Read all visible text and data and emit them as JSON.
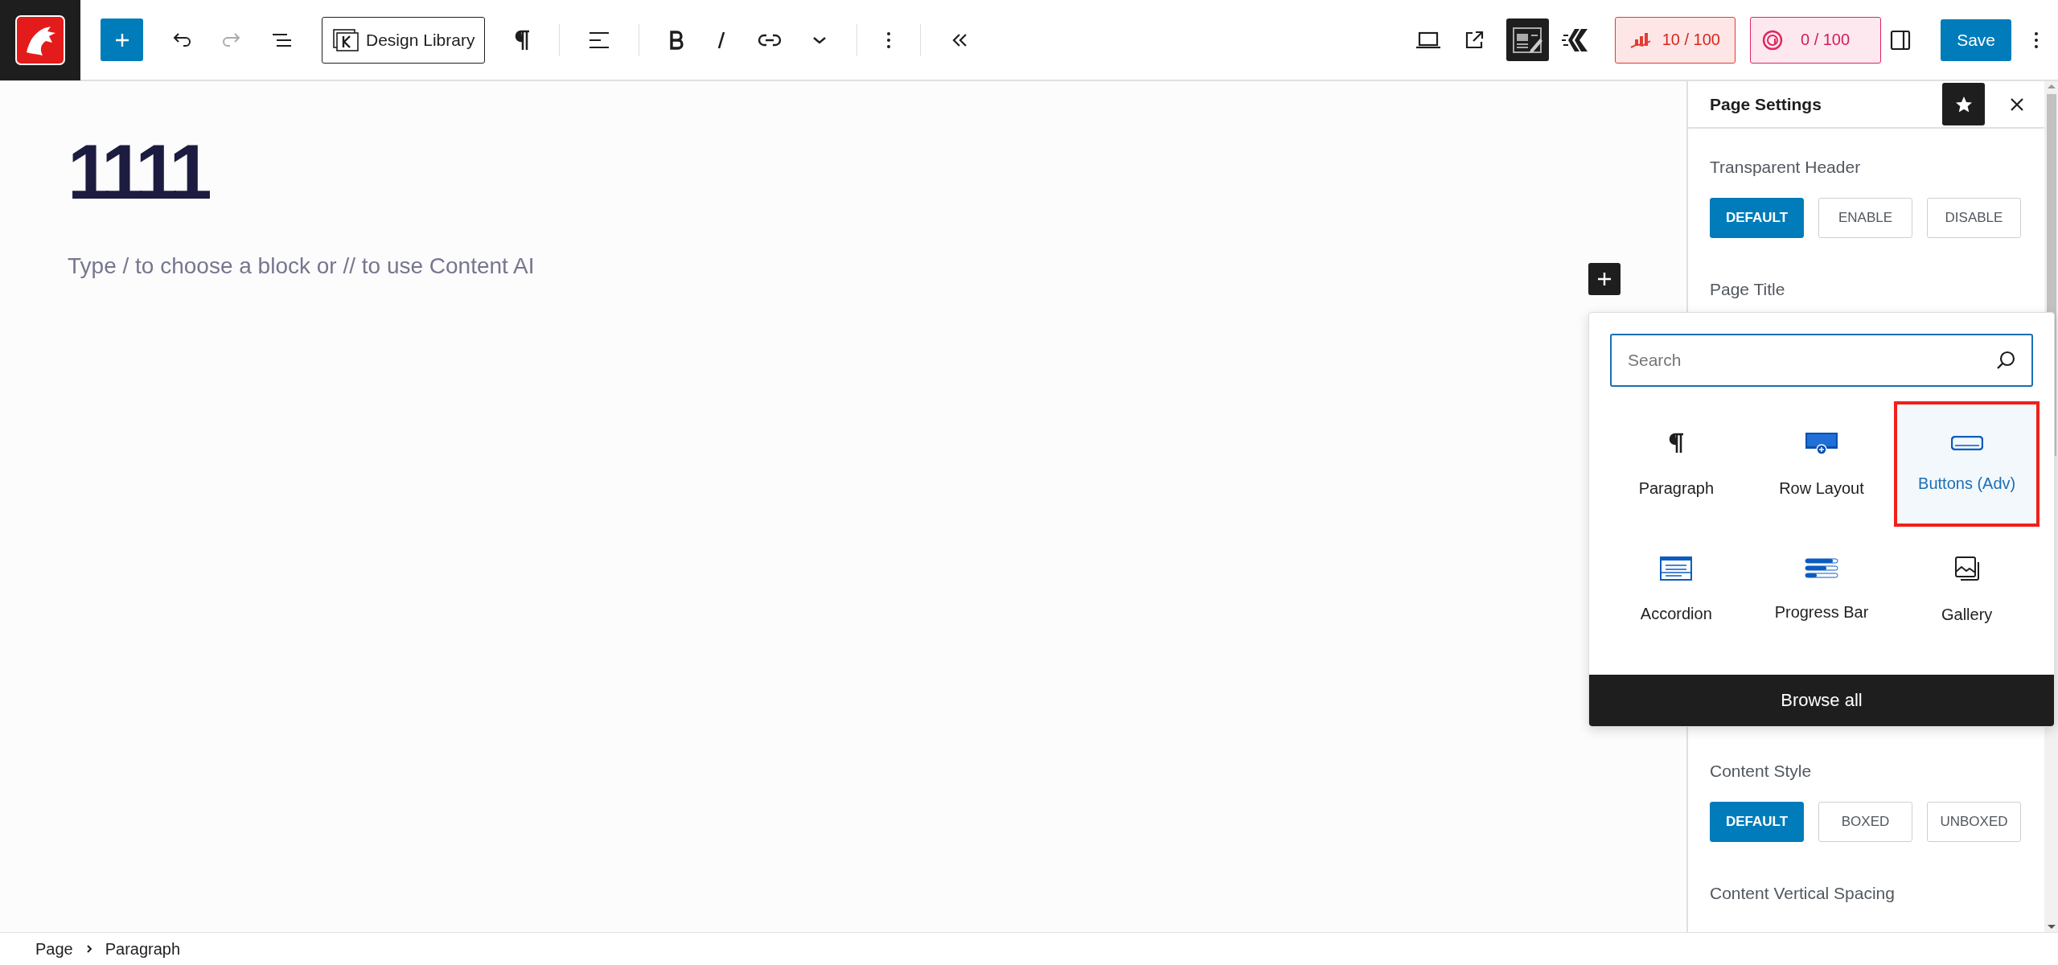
{
  "toolbar": {
    "design_library": "Design Library",
    "scores": [
      {
        "kind": "seo",
        "text": "10 / 100"
      },
      {
        "kind": "ai",
        "text": "0 / 100"
      }
    ],
    "save": "Save"
  },
  "editor": {
    "title": "1111",
    "placeholder": "Type / to choose a block or // to use Content AI"
  },
  "sidebar": {
    "title": "Page Settings",
    "sections": [
      {
        "label": "Transparent Header",
        "options": [
          {
            "label": "DEFAULT",
            "selected": true
          },
          {
            "label": "ENABLE",
            "selected": false
          },
          {
            "label": "DISABLE",
            "selected": false
          }
        ]
      },
      {
        "label": "Page Title"
      },
      {
        "label": "Content Style",
        "options": [
          {
            "label": "DEFAULT",
            "selected": true
          },
          {
            "label": "BOXED",
            "selected": false
          },
          {
            "label": "UNBOXED",
            "selected": false
          }
        ]
      },
      {
        "label": "Content Vertical Spacing"
      }
    ]
  },
  "inserter": {
    "search": {
      "placeholder": "Search"
    },
    "blocks": [
      {
        "kind": "paragraph",
        "label": "Paragraph",
        "selected": false
      },
      {
        "kind": "row",
        "label": "Row Layout",
        "selected": false
      },
      {
        "kind": "buttons",
        "label": "Buttons (Adv)",
        "selected": true
      },
      {
        "kind": "accordion",
        "label": "Accordion",
        "selected": false
      },
      {
        "kind": "progress",
        "label": "Progress Bar",
        "selected": false
      },
      {
        "kind": "gallery",
        "label": "Gallery",
        "selected": false
      }
    ],
    "browse_all": "Browse all"
  },
  "breadcrumb": [
    "Page",
    "Paragraph"
  ]
}
